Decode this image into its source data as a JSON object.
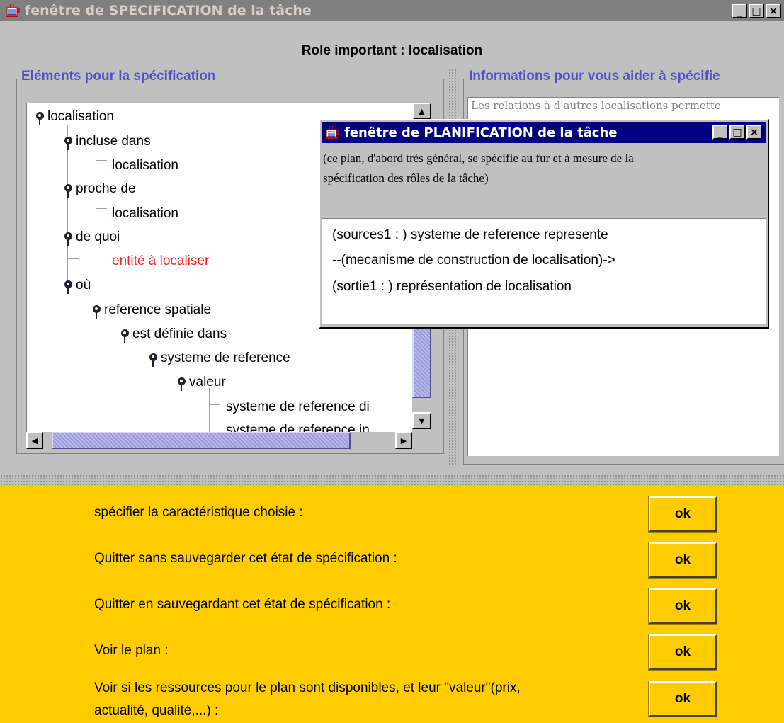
{
  "window": {
    "title": "fenêtre de SPECIFICATION de la tâche",
    "minimize": "_",
    "maximize": "□",
    "close": "×"
  },
  "role_title": "Role important : localisation",
  "left_group": {
    "legend": "Eléments pour la spécification",
    "tree": {
      "root": "localisation",
      "incluse_dans": "incluse dans",
      "incluse_child": "localisation",
      "proche_de": "proche de",
      "proche_child": "localisation",
      "de_quoi": "de quoi",
      "de_quoi_child": "entité à localiser",
      "ou": "où",
      "reference_spatiale": "reference spatiale",
      "est_definie_dans": "est définie dans",
      "systeme_de_reference": "systeme de reference",
      "valeur": "valeur",
      "leaf_1": "systeme de reference di",
      "leaf_2": "systeme de reference in"
    }
  },
  "right_group": {
    "legend": "Informations pour vous aider à spécifie",
    "info_text": "Les relations à d'autres localisations permette"
  },
  "popup": {
    "title": "fenêtre de PLANIFICATION de la tâche",
    "description_line_1": "(ce plan, d'abord très général, se spécifie au fur et à mesure de la",
    "description_line_2": "spécification des rôles de la tâche)",
    "plan_line_1": "(sources1 : ) systeme de reference represente",
    "plan_line_2": "--(mecanisme de construction de localisation)->",
    "plan_line_3": "(sortie1 : ) représentation de localisation"
  },
  "actions": [
    {
      "label": "spécifier la caractéristique choisie :",
      "button": "ok"
    },
    {
      "label": "Quitter sans sauvegarder cet état de spécification :",
      "button": "ok"
    },
    {
      "label": "Quitter en sauvegardant cet état de spécification :",
      "button": "ok"
    },
    {
      "label": "Voir le plan :",
      "button": "ok"
    },
    {
      "label_line_1": "Voir si les ressources pour le plan sont disponibles, et leur \"valeur\"(prix,",
      "label_line_2": "actualité, qualité,...) :",
      "button": "ok"
    }
  ],
  "colors": {
    "legend": "#5a4fc0",
    "highlight_node": "#ff2020",
    "action_area": "#ffcc00",
    "popup_titlebar": "#000080",
    "main_titlebar": "#808080"
  },
  "icons": [
    "java-cup-icon",
    "tree-node-icon",
    "minimize-icon",
    "maximize-icon",
    "close-icon",
    "scroll-up-icon",
    "scroll-down-icon",
    "scroll-left-icon",
    "scroll-right-icon"
  ]
}
